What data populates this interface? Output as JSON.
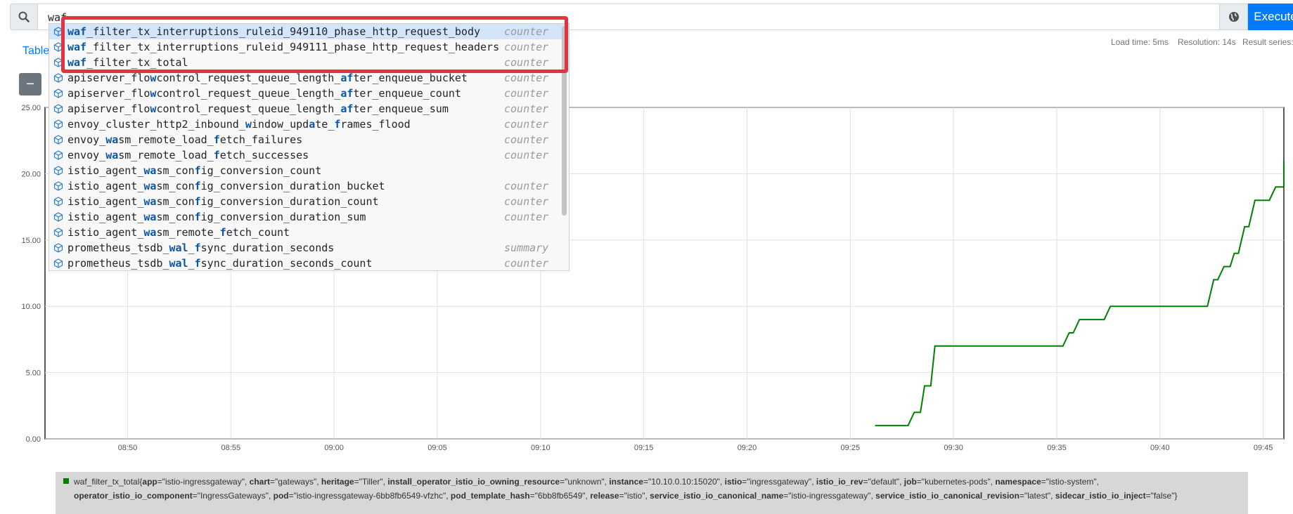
{
  "query": {
    "value": "waf_",
    "execute_label": "Execute",
    "search_icon": "search-icon",
    "globe_icon": "globe-icon"
  },
  "tabs": {
    "table_label": "Table"
  },
  "stats": {
    "load_time": "Load time: 5ms",
    "resolution": "Resolution: 14s",
    "result_series": "Result series:"
  },
  "graph_controls": {
    "collapse_label": "−"
  },
  "autocomplete": {
    "items": [
      {
        "parts": [
          [
            "waf",
            "m"
          ],
          [
            "_filter_tx_interruptions_ruleid_949110_phase_http_request_body",
            ""
          ]
        ],
        "type": "counter"
      },
      {
        "parts": [
          [
            "waf",
            "m"
          ],
          [
            "_filter_tx_interruptions_ruleid_949111_phase_http_request_headers",
            ""
          ]
        ],
        "type": "counter"
      },
      {
        "parts": [
          [
            "waf",
            "m"
          ],
          [
            "_filter_tx_total",
            ""
          ]
        ],
        "type": "counter"
      },
      {
        "parts": [
          [
            "apiserver_flo",
            ""
          ],
          [
            "w",
            "m"
          ],
          [
            "control_request_queue_length_",
            ""
          ],
          [
            "af",
            "m"
          ],
          [
            "ter_enqueue_bucket",
            ""
          ]
        ],
        "type": "counter"
      },
      {
        "parts": [
          [
            "apiserver_flo",
            ""
          ],
          [
            "w",
            "m"
          ],
          [
            "control_request_queue_length_",
            ""
          ],
          [
            "af",
            "m"
          ],
          [
            "ter_enqueue_count",
            ""
          ]
        ],
        "type": "counter"
      },
      {
        "parts": [
          [
            "apiserver_flo",
            ""
          ],
          [
            "w",
            "m"
          ],
          [
            "control_request_queue_length_",
            ""
          ],
          [
            "af",
            "m"
          ],
          [
            "ter_enqueue_sum",
            ""
          ]
        ],
        "type": "counter"
      },
      {
        "parts": [
          [
            "envoy_cluster_http2_inbound_",
            ""
          ],
          [
            "w",
            "m"
          ],
          [
            "indow_upd",
            ""
          ],
          [
            "a",
            "m"
          ],
          [
            "te_",
            ""
          ],
          [
            "f",
            "m"
          ],
          [
            "rames_flood",
            ""
          ]
        ],
        "type": "counter"
      },
      {
        "parts": [
          [
            "envoy_",
            ""
          ],
          [
            "wa",
            "m"
          ],
          [
            "sm_remote_load_",
            ""
          ],
          [
            "f",
            "m"
          ],
          [
            "etch_failures",
            ""
          ]
        ],
        "type": "counter"
      },
      {
        "parts": [
          [
            "envoy_",
            ""
          ],
          [
            "wa",
            "m"
          ],
          [
            "sm_remote_load_",
            ""
          ],
          [
            "f",
            "m"
          ],
          [
            "etch_successes",
            ""
          ]
        ],
        "type": "counter"
      },
      {
        "parts": [
          [
            "istio_agent_",
            ""
          ],
          [
            "wa",
            "m"
          ],
          [
            "sm_con",
            ""
          ],
          [
            "f",
            "m"
          ],
          [
            "ig_conversion_count",
            ""
          ]
        ],
        "type": ""
      },
      {
        "parts": [
          [
            "istio_agent_",
            ""
          ],
          [
            "wa",
            "m"
          ],
          [
            "sm_con",
            ""
          ],
          [
            "f",
            "m"
          ],
          [
            "ig_conversion_duration_bucket",
            ""
          ]
        ],
        "type": "counter"
      },
      {
        "parts": [
          [
            "istio_agent_",
            ""
          ],
          [
            "wa",
            "m"
          ],
          [
            "sm_con",
            ""
          ],
          [
            "f",
            "m"
          ],
          [
            "ig_conversion_duration_count",
            ""
          ]
        ],
        "type": "counter"
      },
      {
        "parts": [
          [
            "istio_agent_",
            ""
          ],
          [
            "wa",
            "m"
          ],
          [
            "sm_con",
            ""
          ],
          [
            "f",
            "m"
          ],
          [
            "ig_conversion_duration_sum",
            ""
          ]
        ],
        "type": "counter"
      },
      {
        "parts": [
          [
            "istio_agent_",
            ""
          ],
          [
            "wa",
            "m"
          ],
          [
            "sm_remote_",
            ""
          ],
          [
            "f",
            "m"
          ],
          [
            "etch_count",
            ""
          ]
        ],
        "type": ""
      },
      {
        "parts": [
          [
            "prometheus_tsdb_",
            ""
          ],
          [
            "wal",
            "m"
          ],
          [
            "_",
            ""
          ],
          [
            "f",
            "m"
          ],
          [
            "sync_duration_seconds",
            ""
          ]
        ],
        "type": "summary"
      },
      {
        "parts": [
          [
            "prometheus_tsdb_",
            ""
          ],
          [
            "wal",
            "m"
          ],
          [
            "_",
            ""
          ],
          [
            "f",
            "m"
          ],
          [
            "sync_duration_seconds_count",
            ""
          ]
        ],
        "type": "counter"
      }
    ]
  },
  "chart_data": {
    "type": "line",
    "x_ticks": [
      "08:50",
      "08:55",
      "09:00",
      "09:05",
      "09:10",
      "09:15",
      "09:20",
      "09:25",
      "09:30",
      "09:35",
      "09:40",
      "09:45"
    ],
    "y_ticks": [
      "0.00",
      "5.00",
      "10.00",
      "15.00",
      "20.00",
      "25.00"
    ],
    "x_range_minutes": [
      526.0,
      586.0
    ],
    "ylim": [
      0,
      25
    ],
    "grid": true,
    "series": [
      {
        "color": "#008000",
        "points": [
          [
            566.2,
            1
          ],
          [
            567.8,
            1
          ],
          [
            568.1,
            2
          ],
          [
            568.4,
            2
          ],
          [
            568.6,
            4
          ],
          [
            568.9,
            4
          ],
          [
            569.1,
            7
          ],
          [
            575.3,
            7
          ],
          [
            575.6,
            8
          ],
          [
            575.8,
            8
          ],
          [
            576.1,
            9
          ],
          [
            577.3,
            9
          ],
          [
            577.6,
            10
          ],
          [
            582.3,
            10
          ],
          [
            582.6,
            12
          ],
          [
            582.8,
            12
          ],
          [
            583.1,
            13
          ],
          [
            583.4,
            13
          ],
          [
            583.6,
            14
          ],
          [
            583.8,
            14
          ],
          [
            584.1,
            16
          ],
          [
            584.3,
            16
          ],
          [
            584.6,
            18
          ],
          [
            585.3,
            18
          ],
          [
            585.6,
            19
          ],
          [
            586.9,
            19
          ],
          [
            587.1,
            20
          ],
          [
            587.3,
            20
          ],
          [
            587.6,
            21
          ],
          [
            588.1,
            21
          ]
        ]
      }
    ]
  },
  "legend": {
    "metric": "waf_filter_tx_total",
    "labels": [
      {
        "k": "app",
        "v": "\"istio-ingressgateway\""
      },
      {
        "k": "chart",
        "v": "\"gateways\""
      },
      {
        "k": "heritage",
        "v": "\"Tiller\""
      },
      {
        "k": "install_operator_istio_io_owning_resource",
        "v": "\"unknown\""
      },
      {
        "k": "instance",
        "v": "\"10.10.0.10:15020\""
      },
      {
        "k": "istio",
        "v": "\"ingressgateway\""
      },
      {
        "k": "istio_io_rev",
        "v": "\"default\""
      },
      {
        "k": "job",
        "v": "\"kubernetes-pods\""
      },
      {
        "k": "namespace",
        "v": "\"istio-system\""
      },
      {
        "k": "operator_istio_io_component",
        "v": "\"IngressGateways\""
      },
      {
        "k": "pod",
        "v": "\"istio-ingressgateway-6bb8fb6549-vfzhc\""
      },
      {
        "k": "pod_template_hash",
        "v": "\"6bb8fb6549\""
      },
      {
        "k": "release",
        "v": "\"istio\""
      },
      {
        "k": "service_istio_io_canonical_name",
        "v": "\"istio-ingressgateway\""
      },
      {
        "k": "service_istio_io_canonical_revision",
        "v": "\"latest\""
      },
      {
        "k": "sidecar_istio_io_inject",
        "v": "\"false\""
      }
    ]
  }
}
